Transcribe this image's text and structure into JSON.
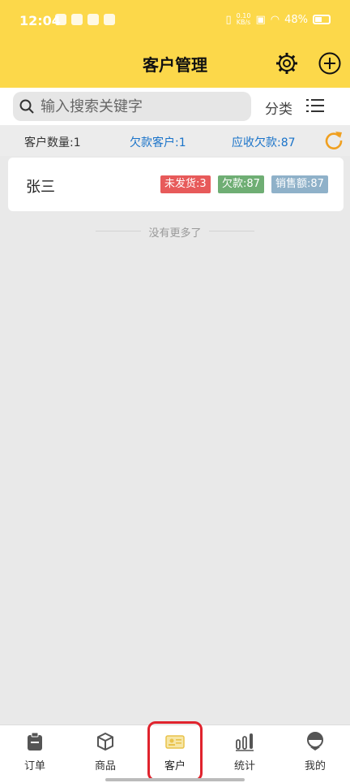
{
  "status_bar": {
    "time": "12:04",
    "speed_top": "0.10",
    "speed_bottom": "KB/s",
    "battery": "48%"
  },
  "header": {
    "title": "客户管理"
  },
  "search": {
    "placeholder": "输入搜索关键字",
    "category_label": "分类"
  },
  "stats": {
    "customer_count": "客户数量:1",
    "debt_customers": "欠款客户:1",
    "receivable": "应收欠款:87"
  },
  "customers": [
    {
      "name": "张三",
      "unshipped": "未发货:3",
      "debt": "欠款:87",
      "sales": "销售额:87"
    }
  ],
  "list_end_text": "没有更多了",
  "tabs": [
    {
      "label": "订单"
    },
    {
      "label": "商品"
    },
    {
      "label": "客户"
    },
    {
      "label": "统计"
    },
    {
      "label": "我的"
    }
  ],
  "colors": {
    "header": "#fcd84a",
    "accent_blue": "#1a73c9",
    "refresh": "#f0a020",
    "highlight": "#e0232d"
  }
}
